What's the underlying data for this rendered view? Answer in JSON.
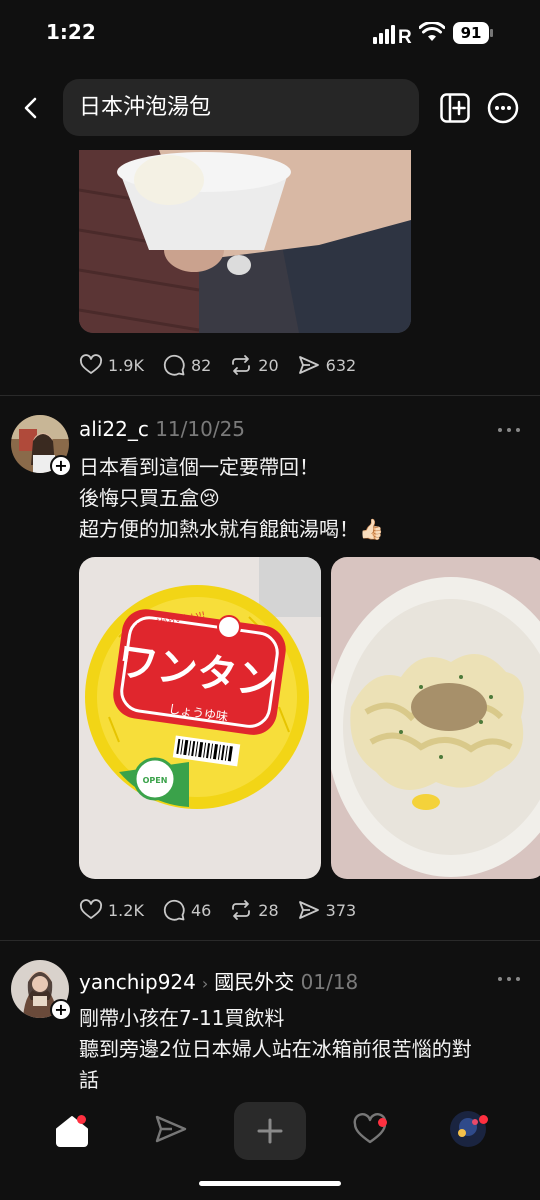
{
  "status_bar": {
    "time": "1:22",
    "carrier": "R",
    "battery": "91"
  },
  "header": {
    "search_query": "日本沖泡湯包"
  },
  "posts": [
    {
      "stats": {
        "likes": "1.9K",
        "comments": "82",
        "reposts": "20",
        "shares": "632"
      }
    },
    {
      "username": "ali22_c",
      "date": "11/10/25",
      "lines": [
        "日本看到這個一定要帶回！",
        "後悔只買五盒😢",
        "超方便的加熱水就有餛飩湯喝！👍🏻"
      ],
      "image_labels": {
        "lid_word": "ワンタン",
        "lid_sub": "しょうゆ味",
        "lid_top": "スープがおいしい!!",
        "open": "OPEN"
      },
      "stats": {
        "likes": "1.2K",
        "comments": "46",
        "reposts": "28",
        "shares": "373"
      }
    },
    {
      "username": "yanchip924",
      "topic": "國民外交",
      "date": "01/18",
      "lines": [
        "剛帶小孩在7-11買飲料",
        "聽到旁邊2位日本婦人站在冰箱前很苦惱的對",
        "話"
      ]
    }
  ],
  "colors": {
    "background": "#101010",
    "accent_notification": "#ff3040",
    "lid_red": "#e0262d",
    "lid_yellow": "#f2d516"
  },
  "nav": {
    "items": [
      "home-icon",
      "send-icon",
      "compose-icon",
      "activity-icon",
      "profile-avatar"
    ]
  }
}
